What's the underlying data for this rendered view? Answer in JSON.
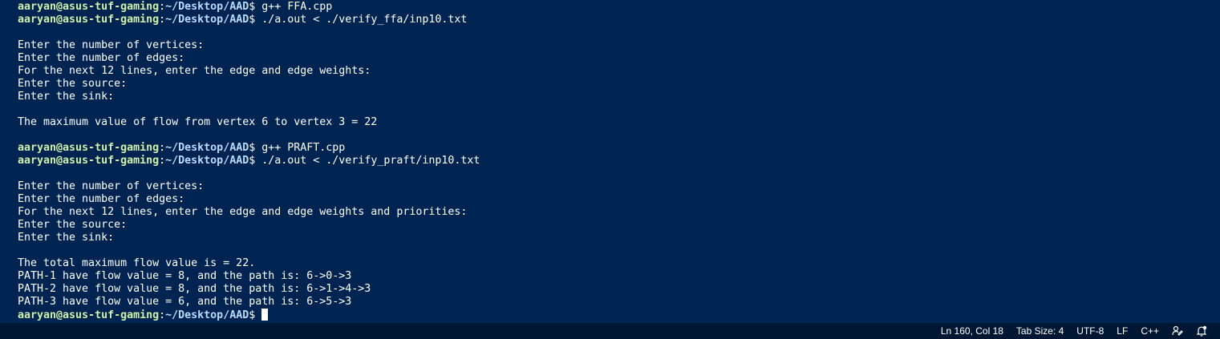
{
  "terminal": {
    "prompt_user": "aaryan@asus-tuf-gaming",
    "prompt_path": "~/Desktop/AAD",
    "session1": {
      "compile_cmd": " g++ FFA.cpp",
      "run_cmd": " ./a.out < ./verify_ffa/inp10.txt",
      "output": [
        "",
        "Enter the number of vertices:",
        "Enter the number of edges:",
        "For the next 12 lines, enter the edge and edge weights:",
        "Enter the source:",
        "Enter the sink:",
        "",
        "The maximum value of flow from vertex 6 to vertex 3 = 22",
        ""
      ]
    },
    "session2": {
      "compile_cmd": " g++ PRAFT.cpp",
      "run_cmd": " ./a.out < ./verify_praft/inp10.txt",
      "output": [
        "",
        "Enter the number of vertices:",
        "Enter the number of edges:",
        "For the next 12 lines, enter the edge and edge weights and priorities:",
        "Enter the source:",
        "Enter the sink:",
        "",
        "The total maximum flow value is = 22.",
        "PATH-1 have flow value = 8, and the path is: 6->0->3",
        "PATH-2 have flow value = 8, and the path is: 6->1->4->3",
        "PATH-3 have flow value = 6, and the path is: 6->5->3"
      ]
    },
    "final_prompt_cmd": " "
  },
  "statusbar": {
    "position": "Ln 160, Col 18",
    "tab_size": "Tab Size: 4",
    "encoding": "UTF-8",
    "eol": "LF",
    "language": "C++",
    "icons": [
      "feedback-icon",
      "bell-icon"
    ]
  },
  "colors": {
    "background": "#002451",
    "statusbar": "#001733",
    "prompt_user": "#d1f1a9",
    "prompt_path": "#bbdaff",
    "text": "#ffffff"
  }
}
